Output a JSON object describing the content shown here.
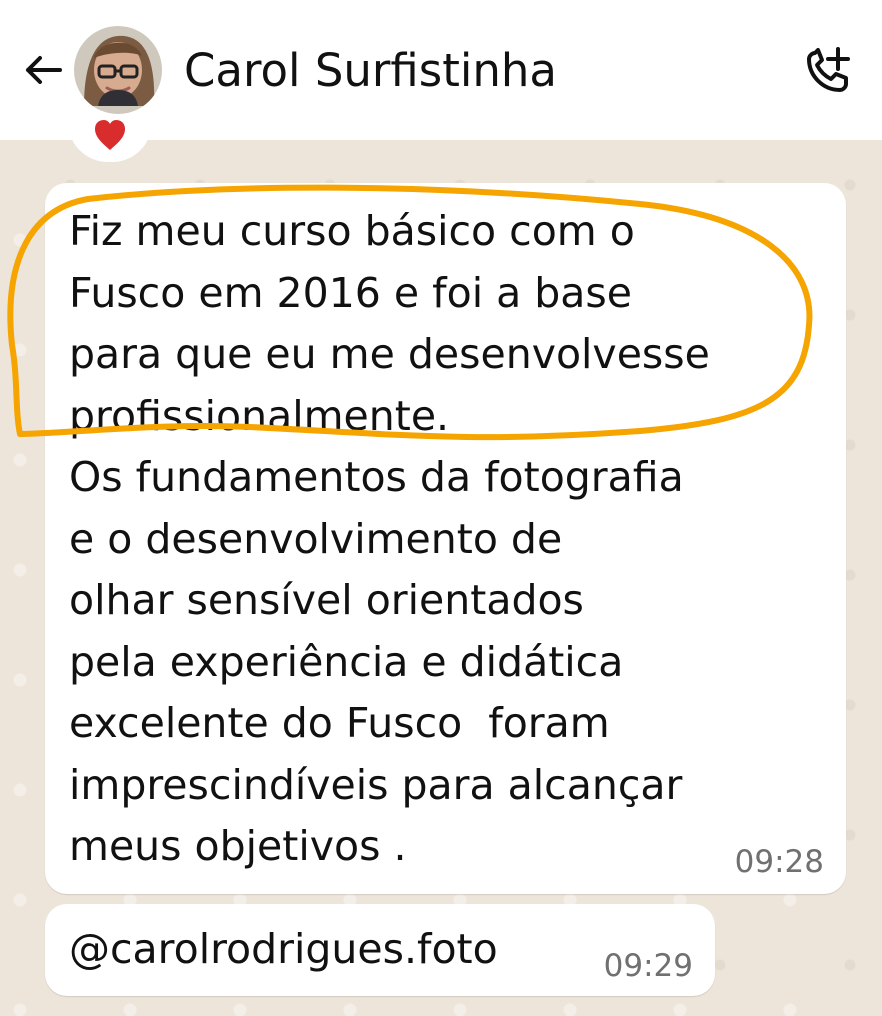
{
  "header": {
    "title": "Carol Surfistinha"
  },
  "icons": {
    "back": "back-arrow-icon",
    "call": "add-call-icon",
    "reaction": "red-heart-icon"
  },
  "messages": [
    {
      "text": "Fiz meu curso básico com o\nFusco em 2016 e foi a base\npara que eu me desenvolvesse\nprofissionalmente.\nOs fundamentos da fotografia\ne o desenvolvimento de\nolhar sensível orientados\npela experiência e didática\nexcelente do Fusco  foram\nimprescindíveis para alcançar\nmeus objetivos .",
      "time": "09:28"
    },
    {
      "text": "@carolrodrigues.foto",
      "time": "09:29"
    }
  ],
  "colors": {
    "background": "#ede5da",
    "bubble": "#ffffff",
    "highlight_stroke": "#f5a400",
    "reaction": "#d92d2d"
  }
}
